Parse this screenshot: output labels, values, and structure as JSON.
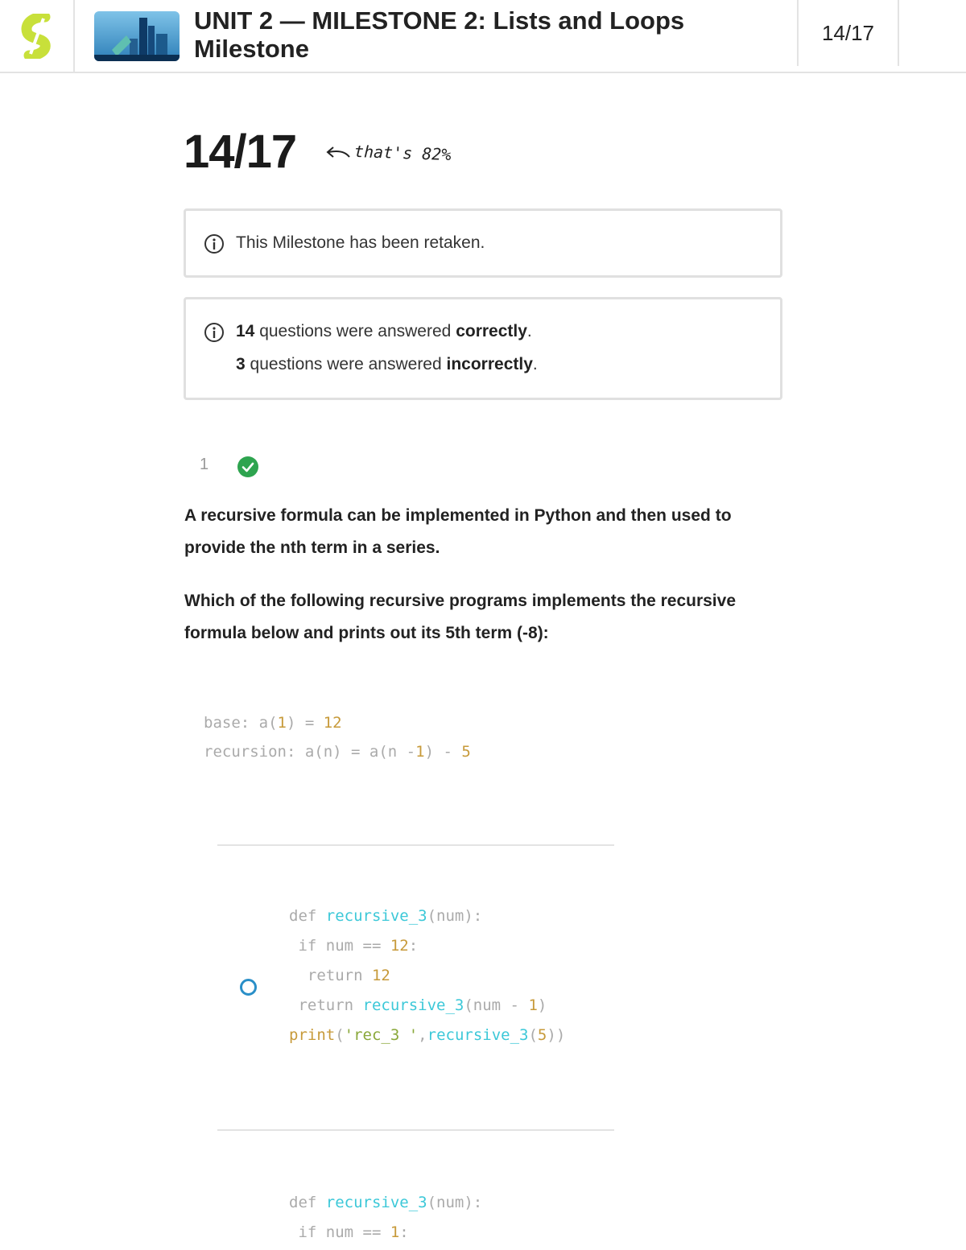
{
  "header": {
    "title": "UNIT 2 — MILESTONE 2: Lists and Loops Milestone",
    "score": "14/17"
  },
  "result": {
    "score": "14/17",
    "percent_note": "that's 82%",
    "retaken_text": "This Milestone has been retaken.",
    "correct_count": "14",
    "correct_text_pre": "questions were answered",
    "correct_word": "correctly",
    "incorrect_count": "3",
    "incorrect_text_pre": "questions were answered",
    "incorrect_word": "incorrectly"
  },
  "question": {
    "number": "1",
    "status": "correct",
    "text1": "A recursive formula can be implemented in Python and then used to provide the nth term in a series.",
    "text2": "Which of the following recursive programs implements the recursive formula below and prints out its 5th term (-8):",
    "formula": [
      "base: a(1) = 12",
      "recursion: a(n) = a(n -1) - 5"
    ],
    "options": [
      {
        "code": [
          "def recursive_3(num):",
          " if num == 12:",
          "  return 12",
          " return recursive_3(num - 1)",
          "print('rec_3 ',recursive_3(5))"
        ]
      },
      {
        "code": [
          "def recursive_3(num):",
          " if num == 1:"
        ]
      }
    ]
  },
  "colors": {
    "accent_green": "#2ea44f",
    "radio_blue": "#2a8fc8",
    "logo_yellow": "#c8e03a"
  }
}
